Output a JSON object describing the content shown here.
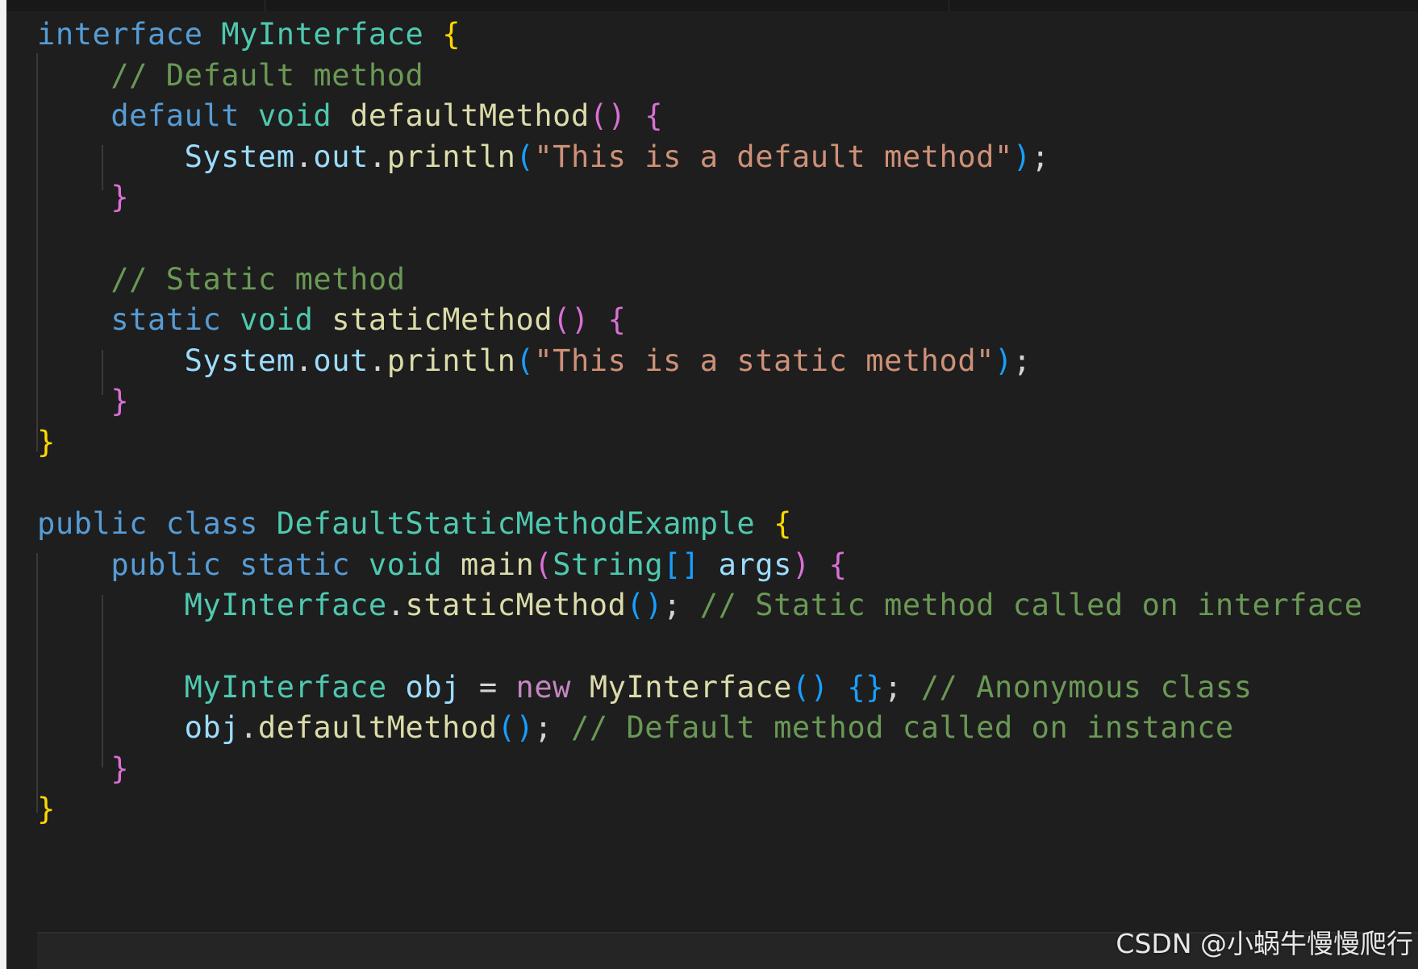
{
  "editor": {
    "theme_colors": {
      "background": "#1e1e1e",
      "keyword": "#569cd6",
      "type": "#4ec9b0",
      "function": "#dcdcaa",
      "variable": "#9cdcfe",
      "string": "#ce9178",
      "comment": "#6a9955",
      "bracket_level_1": "#ffd700",
      "bracket_level_2": "#da70d6",
      "bracket_level_3": "#179fff"
    },
    "lines": [
      {
        "tokens": [
          {
            "text": "interface",
            "kind": "kw"
          },
          {
            "text": " ",
            "kind": "pun"
          },
          {
            "text": "MyInterface",
            "kind": "ty"
          },
          {
            "text": " ",
            "kind": "pun"
          },
          {
            "text": "{",
            "kind": "br1"
          }
        ]
      },
      {
        "tokens": [
          {
            "text": "    ",
            "kind": "pun"
          },
          {
            "text": "// Default method",
            "kind": "com"
          }
        ]
      },
      {
        "tokens": [
          {
            "text": "    ",
            "kind": "pun"
          },
          {
            "text": "default",
            "kind": "kw"
          },
          {
            "text": " ",
            "kind": "pun"
          },
          {
            "text": "void",
            "kind": "ty"
          },
          {
            "text": " ",
            "kind": "pun"
          },
          {
            "text": "defaultMethod",
            "kind": "fn"
          },
          {
            "text": "()",
            "kind": "br2"
          },
          {
            "text": " ",
            "kind": "pun"
          },
          {
            "text": "{",
            "kind": "br2"
          }
        ]
      },
      {
        "tokens": [
          {
            "text": "        ",
            "kind": "pun"
          },
          {
            "text": "System",
            "kind": "var"
          },
          {
            "text": ".",
            "kind": "pun"
          },
          {
            "text": "out",
            "kind": "var"
          },
          {
            "text": ".",
            "kind": "pun"
          },
          {
            "text": "println",
            "kind": "fn"
          },
          {
            "text": "(",
            "kind": "br3"
          },
          {
            "text": "\"This is a default method\"",
            "kind": "str"
          },
          {
            "text": ")",
            "kind": "br3"
          },
          {
            "text": ";",
            "kind": "pun"
          }
        ]
      },
      {
        "tokens": [
          {
            "text": "    ",
            "kind": "pun"
          },
          {
            "text": "}",
            "kind": "br2"
          }
        ]
      },
      {
        "tokens": []
      },
      {
        "tokens": [
          {
            "text": "    ",
            "kind": "pun"
          },
          {
            "text": "// Static method",
            "kind": "com"
          }
        ]
      },
      {
        "tokens": [
          {
            "text": "    ",
            "kind": "pun"
          },
          {
            "text": "static",
            "kind": "kw"
          },
          {
            "text": " ",
            "kind": "pun"
          },
          {
            "text": "void",
            "kind": "ty"
          },
          {
            "text": " ",
            "kind": "pun"
          },
          {
            "text": "staticMethod",
            "kind": "fn"
          },
          {
            "text": "()",
            "kind": "br2"
          },
          {
            "text": " ",
            "kind": "pun"
          },
          {
            "text": "{",
            "kind": "br2"
          }
        ]
      },
      {
        "tokens": [
          {
            "text": "        ",
            "kind": "pun"
          },
          {
            "text": "System",
            "kind": "var"
          },
          {
            "text": ".",
            "kind": "pun"
          },
          {
            "text": "out",
            "kind": "var"
          },
          {
            "text": ".",
            "kind": "pun"
          },
          {
            "text": "println",
            "kind": "fn"
          },
          {
            "text": "(",
            "kind": "br3"
          },
          {
            "text": "\"This is a static method\"",
            "kind": "str"
          },
          {
            "text": ")",
            "kind": "br3"
          },
          {
            "text": ";",
            "kind": "pun"
          }
        ]
      },
      {
        "tokens": [
          {
            "text": "    ",
            "kind": "pun"
          },
          {
            "text": "}",
            "kind": "br2"
          }
        ]
      },
      {
        "tokens": [
          {
            "text": "}",
            "kind": "br1"
          }
        ]
      },
      {
        "tokens": []
      },
      {
        "tokens": [
          {
            "text": "public",
            "kind": "kw"
          },
          {
            "text": " ",
            "kind": "pun"
          },
          {
            "text": "class",
            "kind": "kw"
          },
          {
            "text": " ",
            "kind": "pun"
          },
          {
            "text": "DefaultStaticMethodExample",
            "kind": "ty"
          },
          {
            "text": " ",
            "kind": "pun"
          },
          {
            "text": "{",
            "kind": "br1"
          }
        ]
      },
      {
        "tokens": [
          {
            "text": "    ",
            "kind": "pun"
          },
          {
            "text": "public",
            "kind": "kw"
          },
          {
            "text": " ",
            "kind": "pun"
          },
          {
            "text": "static",
            "kind": "kw"
          },
          {
            "text": " ",
            "kind": "pun"
          },
          {
            "text": "void",
            "kind": "ty"
          },
          {
            "text": " ",
            "kind": "pun"
          },
          {
            "text": "main",
            "kind": "fn"
          },
          {
            "text": "(",
            "kind": "br2"
          },
          {
            "text": "String",
            "kind": "ty"
          },
          {
            "text": "[]",
            "kind": "br3"
          },
          {
            "text": " ",
            "kind": "pun"
          },
          {
            "text": "args",
            "kind": "var"
          },
          {
            "text": ")",
            "kind": "br2"
          },
          {
            "text": " ",
            "kind": "pun"
          },
          {
            "text": "{",
            "kind": "br2"
          }
        ]
      },
      {
        "tokens": [
          {
            "text": "        ",
            "kind": "pun"
          },
          {
            "text": "MyInterface",
            "kind": "ty"
          },
          {
            "text": ".",
            "kind": "pun"
          },
          {
            "text": "staticMethod",
            "kind": "fn"
          },
          {
            "text": "()",
            "kind": "br3"
          },
          {
            "text": "; ",
            "kind": "pun"
          },
          {
            "text": "// Static method called on interface",
            "kind": "com"
          }
        ]
      },
      {
        "tokens": []
      },
      {
        "tokens": [
          {
            "text": "        ",
            "kind": "pun"
          },
          {
            "text": "MyInterface",
            "kind": "ty"
          },
          {
            "text": " ",
            "kind": "pun"
          },
          {
            "text": "obj",
            "kind": "var"
          },
          {
            "text": " = ",
            "kind": "pun"
          },
          {
            "text": "new",
            "kind": "ctl"
          },
          {
            "text": " ",
            "kind": "pun"
          },
          {
            "text": "MyInterface",
            "kind": "fn"
          },
          {
            "text": "()",
            "kind": "br3"
          },
          {
            "text": " ",
            "kind": "pun"
          },
          {
            "text": "{}",
            "kind": "br3"
          },
          {
            "text": "; ",
            "kind": "pun"
          },
          {
            "text": "// Anonymous class",
            "kind": "com"
          }
        ]
      },
      {
        "tokens": [
          {
            "text": "        ",
            "kind": "pun"
          },
          {
            "text": "obj",
            "kind": "var"
          },
          {
            "text": ".",
            "kind": "pun"
          },
          {
            "text": "defaultMethod",
            "kind": "fn"
          },
          {
            "text": "()",
            "kind": "br3"
          },
          {
            "text": "; ",
            "kind": "pun"
          },
          {
            "text": "// Default method called on instance",
            "kind": "com"
          }
        ]
      },
      {
        "tokens": [
          {
            "text": "    ",
            "kind": "pun"
          },
          {
            "text": "}",
            "kind": "br2"
          }
        ]
      },
      {
        "tokens": [
          {
            "text": "}",
            "kind": "br1"
          }
        ]
      }
    ]
  },
  "watermark": {
    "text": "CSDN @小蜗牛慢慢爬行"
  }
}
